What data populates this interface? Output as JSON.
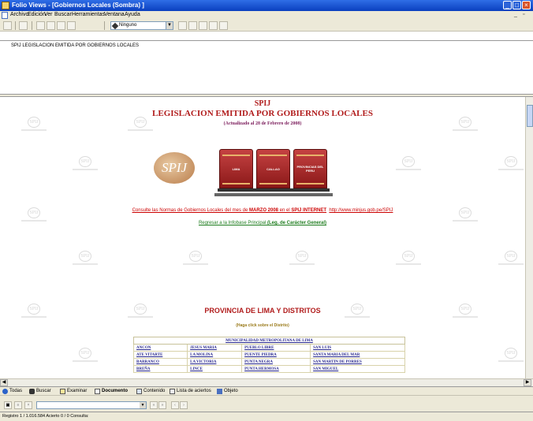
{
  "window": {
    "title": "Folio Views - [Gobiernos Locales (Sombra) ]",
    "controls": [
      "minimize",
      "maximize",
      "close"
    ]
  },
  "menu": {
    "items": [
      "Archivo",
      "Edición",
      "Ver",
      "Buscar",
      "Herramientas",
      "Ventana",
      "Ayuda"
    ]
  },
  "toolbar": {
    "style_select": "Ninguno"
  },
  "contents_pane": {
    "entry": "SPIJ LEGISLACION EMITIDA POR GOBIERNOS LOCALES"
  },
  "document": {
    "brand": "SPIJ",
    "heading": "LEGISLACION EMITIDA POR GOBIERNOS LOCALES",
    "subtitle": "(Actualizado al 28 de Febrero de 2008)",
    "logo_text": "SPIJ",
    "books": [
      "LIMA",
      "CALLAO",
      "PROVINCIAS DEL PERU"
    ],
    "consult": {
      "prefix": "Consulte las Normas de Gobiernos Locales del mes de ",
      "month": "MARZO 2008",
      "middle": " en el ",
      "service": "SPIJ INTERNET",
      "url": "http://www.minjus.gob.pe/SPIJ"
    },
    "return_link": {
      "prefix": "Regresar a la Infobase Principal ",
      "target": "(Leg. de Carácter General)"
    },
    "province_title": "PROVINCIA DE LIMA Y DISTRITOS",
    "province_hint": "(Haga click sobre el Distrito)",
    "table_header": "MUNICIPALIDAD METROPOLITANA DE LIMA",
    "districts": [
      [
        "ANCON",
        "JESUS MARIA",
        "PUEBLO LIBRE",
        "SAN LUIS"
      ],
      [
        "ATE VITARTE",
        "LA MOLINA",
        "PUENTE PIEDRA",
        "SANTA MARIA DEL MAR"
      ],
      [
        "BARRANCO",
        "LA VICTORIA",
        "PUNTA NEGRA",
        "SAN MARTIN DE PORRES"
      ],
      [
        "BREÑA",
        "LINCE",
        "PUNTA HERMOSA",
        "SAN MIGUEL"
      ]
    ]
  },
  "tabs": [
    {
      "label": "Todas",
      "icon": "globe-icon",
      "active": false
    },
    {
      "label": "Buscar",
      "icon": "binoculars-icon",
      "active": false
    },
    {
      "label": "Examinar",
      "icon": "browse-icon",
      "active": false
    },
    {
      "label": "Documento",
      "icon": "document-icon",
      "active": true
    },
    {
      "label": "Contenido",
      "icon": "contents-icon",
      "active": false
    },
    {
      "label": "Lista de aciertos",
      "icon": "hitlist-icon",
      "active": false
    },
    {
      "label": "Objeto",
      "icon": "object-icon",
      "active": false
    }
  ],
  "statusbar": {
    "text": "Registro 1 / 1.016.584   Acierto 0 / 0   Consulta:"
  },
  "colors": {
    "title_red": "#b11c1c",
    "link_red": "#cc0000",
    "link_green": "#1d7c1d",
    "table_text": "#2a2a90",
    "chrome": "#ece9d8"
  }
}
